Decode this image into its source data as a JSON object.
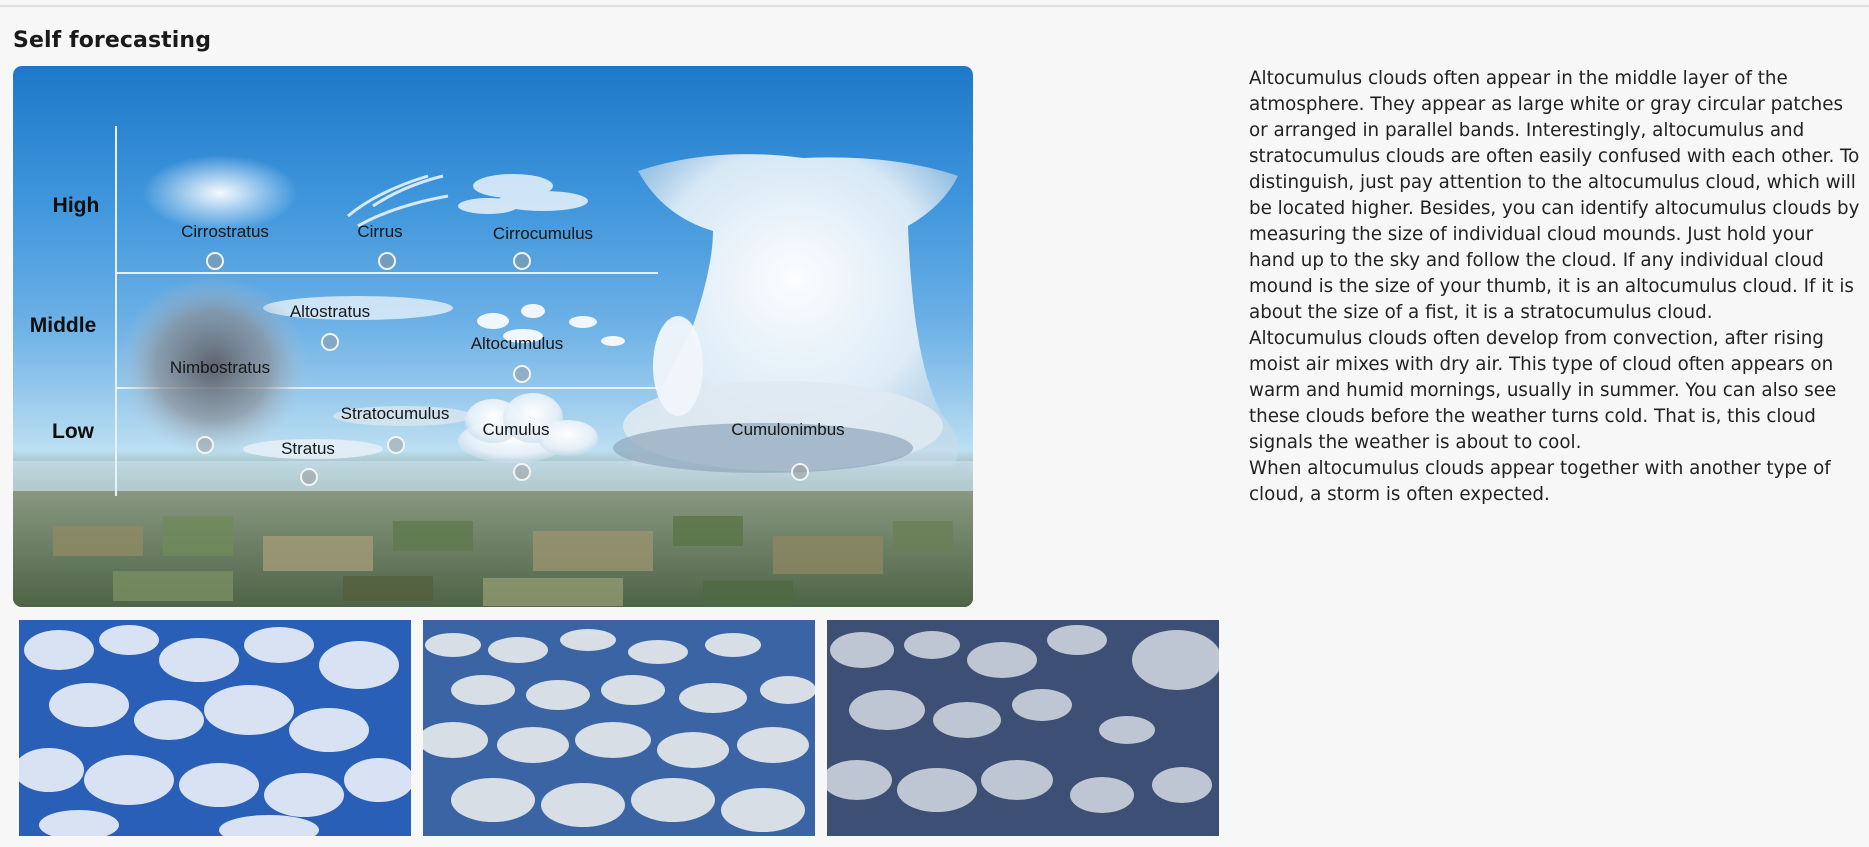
{
  "page": {
    "title": "Self forecasting"
  },
  "diagram": {
    "levels": {
      "high": "High",
      "middle": "Middle",
      "low": "Low"
    },
    "clouds": {
      "cirrostratus": "Cirrostratus",
      "cirrus": "Cirrus",
      "cirrocumulus": "Cirrocumulus",
      "altostratus": "Altostratus",
      "altocumulus": "Altocumulus",
      "nimbostratus": "Nimbostratus",
      "stratocumulus": "Stratocumulus",
      "cumulus": "Cumulus",
      "stratus": "Stratus",
      "cumulonimbus": "Cumulonimbus"
    }
  },
  "description": {
    "paragraphs": [
      "Altocumulus clouds often appear in the middle layer of the atmosphere. They appear as large white or gray circular patches or arranged in parallel bands. Interestingly, altocumulus and stratocumulus clouds are often easily confused with each other. To distinguish, just pay attention to the altocumulus cloud, which will be located higher. Besides, you can identify altocumulus clouds by measuring the size of individual cloud mounds. Just hold your hand up to the sky and follow the cloud. If any individual cloud mound is the size of your thumb, it is an altocumulus cloud. If it is about the size of a fist, it is a stratocumulus cloud.",
      "Altocumulus clouds often develop from convection, after rising moist air mixes with dry air. This type of cloud often appears on warm and humid mornings, usually in summer. You can also see these clouds before the weather turns cold. That is, this cloud signals the weather is about to cool.",
      "When altocumulus clouds appear together with another type of cloud, a storm is often expected."
    ]
  },
  "photos": [
    {
      "name": "altocumulus-photo-1"
    },
    {
      "name": "altocumulus-photo-2"
    },
    {
      "name": "altocumulus-photo-3"
    }
  ],
  "colors": {
    "sky_top": "#1e78c8",
    "sky_bottom": "#bcdff2",
    "ground": "#6d8461",
    "text": "#222222",
    "background": "#f7f7f7"
  }
}
